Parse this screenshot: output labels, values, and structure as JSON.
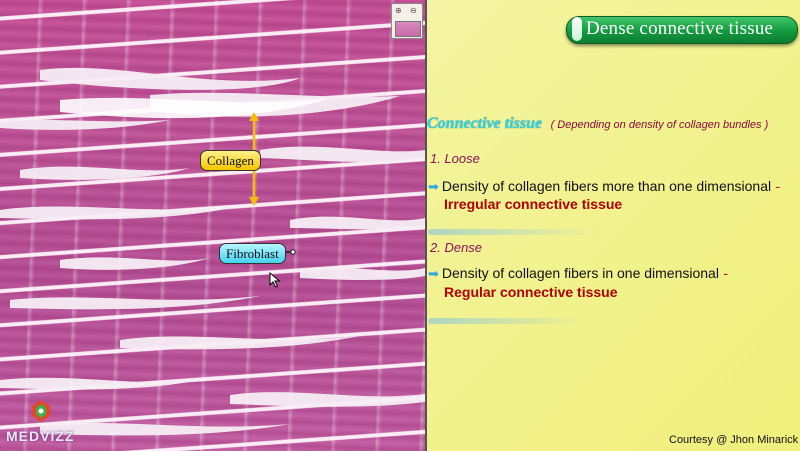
{
  "slide": {
    "title": "Dense connective tissue",
    "heading": "Connective tissue",
    "heading_sub": "( Depending on density of collagen bundles )",
    "types": [
      {
        "label": "1. Loose",
        "description": "Density of collagen fibers more than one dimensional",
        "dash": "-",
        "result": "Irregular connective tissue"
      },
      {
        "label": "2. Dense",
        "description": "Density of collagen fibers in one dimensional",
        "dash": "-",
        "result": "Regular connective tissue"
      }
    ],
    "courtesy": "Courtesy @ Jhon Minarick"
  },
  "micrograph": {
    "labels": {
      "collagen": "Collagen",
      "fibroblast": "Fibroblast"
    }
  },
  "logo": {
    "text": "MEDVIZZ"
  },
  "colors": {
    "title_green": "#139a3e",
    "heading_cyan": "#2ed3e8",
    "type_purple": "#8b1358",
    "result_red": "#b00000",
    "tissue_pink": "#c25a9c",
    "background_yellow": "#f3f39a"
  },
  "icons": [
    "bullet-arrow-icon",
    "cursor-arrow-icon",
    "medvizz-logo-icon",
    "navigator-zoom-icon"
  ]
}
